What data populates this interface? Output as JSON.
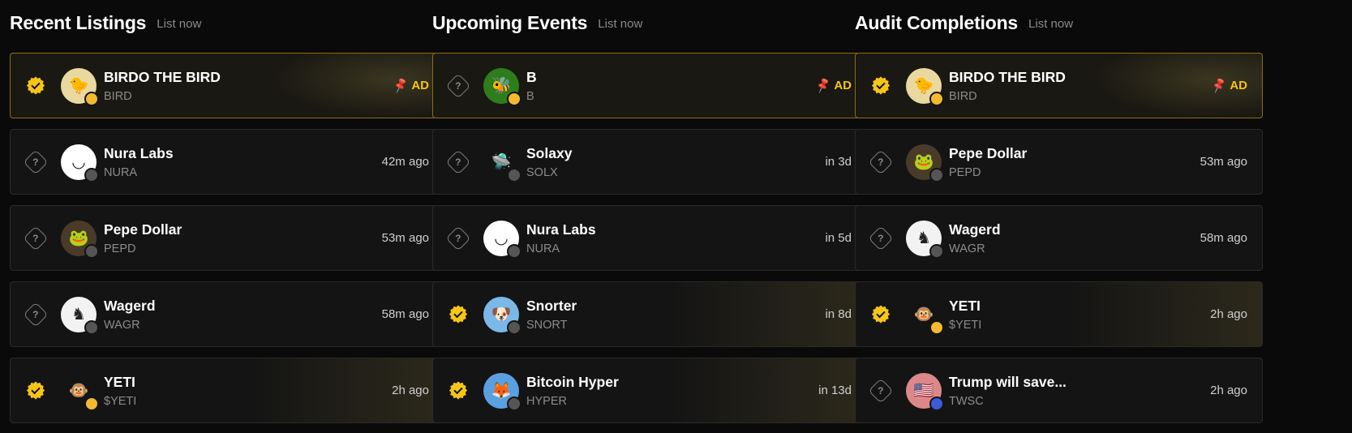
{
  "columns": [
    {
      "title": "Recent Listings",
      "link": "List now",
      "items": [
        {
          "verified": true,
          "name": "BIRDO THE BIRD",
          "ticker": "BIRD",
          "meta": "",
          "ad": "AD",
          "avatar_bg": "#e9d9a0",
          "avatar_glyph": "🐤",
          "chain": "bnb",
          "art": true
        },
        {
          "verified": false,
          "name": "Nura Labs",
          "ticker": "NURA",
          "meta": "42m ago",
          "ad": "",
          "avatar_bg": "#ffffff",
          "avatar_glyph": "◡",
          "chain": "eth",
          "art": false
        },
        {
          "verified": false,
          "name": "Pepe Dollar",
          "ticker": "PEPD",
          "meta": "53m ago",
          "ad": "",
          "avatar_bg": "#4a3a2a",
          "avatar_glyph": "🐸",
          "chain": "eth",
          "art": false
        },
        {
          "verified": false,
          "name": "Wagerd",
          "ticker": "WAGR",
          "meta": "58m ago",
          "ad": "",
          "avatar_bg": "#f2f2f2",
          "avatar_glyph": "♞",
          "chain": "eth",
          "art": false
        },
        {
          "verified": true,
          "name": "YETI",
          "ticker": "$YETI",
          "meta": "2h ago",
          "ad": "",
          "avatar_bg": "#141414",
          "avatar_glyph": "🐵",
          "chain": "bnb",
          "art": true
        }
      ]
    },
    {
      "title": "Upcoming Events",
      "link": "List now",
      "items": [
        {
          "verified": false,
          "name": "B",
          "ticker": "B",
          "meta": "",
          "ad": "AD",
          "avatar_bg": "#2e7d1c",
          "avatar_glyph": "🐝",
          "chain": "bnb",
          "art": false
        },
        {
          "verified": false,
          "name": "Solaxy",
          "ticker": "SOLX",
          "meta": "in 3d",
          "ad": "",
          "avatar_bg": "#141414",
          "avatar_glyph": "🛸",
          "chain": "eth",
          "art": false
        },
        {
          "verified": false,
          "name": "Nura Labs",
          "ticker": "NURA",
          "meta": "in 5d",
          "ad": "",
          "avatar_bg": "#ffffff",
          "avatar_glyph": "◡",
          "chain": "eth",
          "art": false
        },
        {
          "verified": true,
          "name": "Snorter",
          "ticker": "SNORT",
          "meta": "in 8d",
          "ad": "",
          "avatar_bg": "#7ab8e8",
          "avatar_glyph": "🐶",
          "chain": "eth",
          "art": true
        },
        {
          "verified": true,
          "name": "Bitcoin Hyper",
          "ticker": "HYPER",
          "meta": "in 13d",
          "ad": "",
          "avatar_bg": "#5aa0e0",
          "avatar_glyph": "🦊",
          "chain": "eth",
          "art": true
        }
      ]
    },
    {
      "title": "Audit Completions",
      "link": "List now",
      "items": [
        {
          "verified": true,
          "name": "BIRDO THE BIRD",
          "ticker": "BIRD",
          "meta": "",
          "ad": "AD",
          "avatar_bg": "#e9d9a0",
          "avatar_glyph": "🐤",
          "chain": "bnb",
          "art": true
        },
        {
          "verified": false,
          "name": "Pepe Dollar",
          "ticker": "PEPD",
          "meta": "53m ago",
          "ad": "",
          "avatar_bg": "#4a3a2a",
          "avatar_glyph": "🐸",
          "chain": "eth",
          "art": false
        },
        {
          "verified": false,
          "name": "Wagerd",
          "ticker": "WAGR",
          "meta": "58m ago",
          "ad": "",
          "avatar_bg": "#f2f2f2",
          "avatar_glyph": "♞",
          "chain": "eth",
          "art": false
        },
        {
          "verified": true,
          "name": "YETI",
          "ticker": "$YETI",
          "meta": "2h ago",
          "ad": "",
          "avatar_bg": "#141414",
          "avatar_glyph": "🐵",
          "chain": "bnb",
          "art": true
        },
        {
          "verified": false,
          "name": "Trump will save...",
          "ticker": "TWSC",
          "meta": "2h ago",
          "ad": "",
          "avatar_bg": "#d88",
          "avatar_glyph": "🇺🇸",
          "chain": "sol",
          "art": false
        }
      ]
    }
  ],
  "icons": {
    "verified": "verified-badge-icon",
    "unknown": "unverified-question-icon",
    "pin": "pin-icon"
  },
  "colors": {
    "accent": "#f5c518",
    "background": "#0a0a0a",
    "card": "#141414",
    "ad_border": "#8a6f10"
  }
}
